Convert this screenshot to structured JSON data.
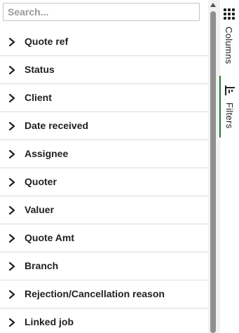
{
  "search": {
    "placeholder": "Search..."
  },
  "fields": [
    "Quote ref",
    "Status",
    "Client",
    "Date received",
    "Assignee",
    "Quoter",
    "Valuer",
    "Quote Amt",
    "Branch",
    "Rejection/Cancellation reason",
    "Linked job"
  ],
  "side_tabs": {
    "columns": {
      "label": "Columns",
      "icon": "grid-icon"
    },
    "filters": {
      "label": "Filters",
      "icon": "filter-icon"
    }
  },
  "colors": {
    "active_tab_border": "#2e7d32",
    "scroll_thumb": "#8f8f8f"
  }
}
